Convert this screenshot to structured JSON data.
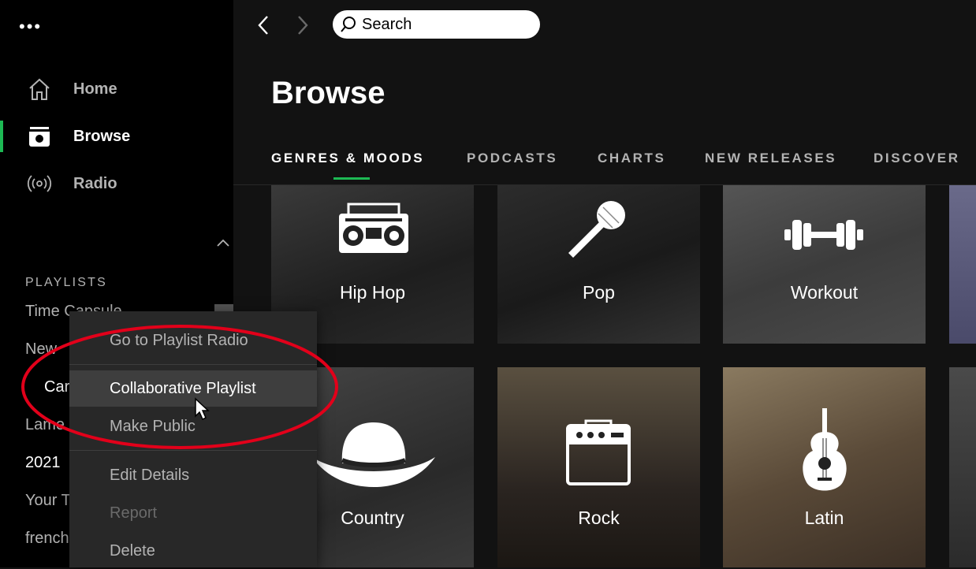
{
  "sidebar": {
    "more_icon": "more-dots-icon",
    "nav": [
      {
        "label": "Home",
        "icon": "home-icon"
      },
      {
        "label": "Browse",
        "icon": "browse-icon",
        "active": true
      },
      {
        "label": "Radio",
        "icon": "radio-icon"
      }
    ],
    "collapse_icon": "chevron-up-icon",
    "playlists_header": "PLAYLISTS",
    "playlists": [
      "Time Capsule",
      "New",
      "Car",
      "Lame",
      "2021",
      "Your T",
      "french"
    ]
  },
  "topbar": {
    "back_icon": "chevron-left-icon",
    "forward_icon": "chevron-right-icon",
    "search_placeholder": "Search"
  },
  "main": {
    "title": "Browse",
    "tabs": [
      "GENRES & MOODS",
      "PODCASTS",
      "CHARTS",
      "NEW RELEASES",
      "DISCOVER"
    ],
    "active_tab": 0,
    "tiles": [
      {
        "label": "Hip Hop",
        "icon": "boombox-icon"
      },
      {
        "label": "Pop",
        "icon": "microphone-icon"
      },
      {
        "label": "Workout",
        "icon": "dumbbell-icon"
      },
      {
        "label": "Country",
        "icon": "cowboy-hat-icon"
      },
      {
        "label": "Rock",
        "icon": "amplifier-icon"
      },
      {
        "label": "Latin",
        "icon": "guitar-icon"
      }
    ]
  },
  "context_menu": {
    "items": [
      {
        "label": "Go to Playlist Radio"
      },
      {
        "label": "Collaborative Playlist",
        "hover": true
      },
      {
        "label": "Make Public"
      },
      {
        "label": "Edit Details"
      },
      {
        "label": "Report",
        "disabled": true
      },
      {
        "label": "Delete"
      }
    ]
  },
  "colors": {
    "accent": "#1db954",
    "annotation": "#e2001a",
    "background": "#121212",
    "sidebar": "#000000",
    "menu": "#282828"
  }
}
